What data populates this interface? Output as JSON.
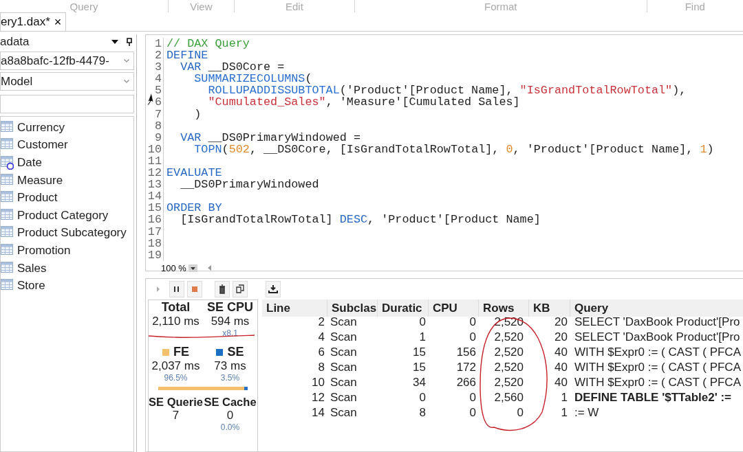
{
  "ribbon": {
    "groups": [
      "Query",
      "View",
      "Edit",
      "Format",
      "Find"
    ]
  },
  "document_tabs": [
    {
      "label": "ery1.dax*",
      "close": "×",
      "selected": true
    }
  ],
  "metadata_panel": {
    "title": "adata",
    "model_dropdown": "a8a8bafc-12fb-4479-",
    "perspective_dropdown": "Model",
    "tables": [
      {
        "label": "Currency",
        "kind": "table"
      },
      {
        "label": "Customer",
        "kind": "table"
      },
      {
        "label": "Date",
        "kind": "date"
      },
      {
        "label": "Measure",
        "kind": "table"
      },
      {
        "label": "Product",
        "kind": "table"
      },
      {
        "label": "Product Category",
        "kind": "table"
      },
      {
        "label": "Product Subcategory",
        "kind": "table"
      },
      {
        "label": "Promotion",
        "kind": "table"
      },
      {
        "label": "Sales",
        "kind": "table"
      },
      {
        "label": "Store",
        "kind": "table"
      }
    ]
  },
  "editor": {
    "zoom": "100 %",
    "lines": [
      {
        "number": "1",
        "tokens": [
          {
            "t": "// DAX Query",
            "kind": "comment"
          }
        ]
      },
      {
        "number": "2",
        "tokens": [
          {
            "t": "DEFINE",
            "kind": "keyword"
          }
        ]
      },
      {
        "number": "3",
        "tokens": [
          {
            "t": "  VAR",
            "kind": "keyword"
          },
          {
            "t": " __DS0Core =",
            "kind": "plain"
          }
        ]
      },
      {
        "number": "4",
        "tokens": [
          {
            "t": "    SUMMARIZECOLUMNS",
            "kind": "function"
          },
          {
            "t": "(",
            "kind": "plain"
          }
        ]
      },
      {
        "number": "5",
        "tokens": [
          {
            "t": "      ROLLUPADDISSUBTOTAL",
            "kind": "function"
          },
          {
            "t": "('Product'[Product Name], ",
            "kind": "plain"
          },
          {
            "t": "\"IsGrandTotalRowTotal\"",
            "kind": "string"
          },
          {
            "t": "),",
            "kind": "plain"
          }
        ]
      },
      {
        "number": "6",
        "tokens": [
          {
            "t": "      \"Cumulated_Sales\"",
            "kind": "string"
          },
          {
            "t": ", 'Measure'[Cumulated Sales]",
            "kind": "plain"
          }
        ]
      },
      {
        "number": "7",
        "tokens": [
          {
            "t": "    )",
            "kind": "plain"
          }
        ]
      },
      {
        "number": "8"
      },
      {
        "number": "9",
        "tokens": [
          {
            "t": "  VAR",
            "kind": "keyword"
          },
          {
            "t": " __DS0PrimaryWindowed =",
            "kind": "plain"
          }
        ]
      },
      {
        "number": "10",
        "tokens": [
          {
            "t": "    TOPN",
            "kind": "function"
          },
          {
            "t": "(",
            "kind": "plain"
          },
          {
            "t": "502",
            "kind": "number"
          },
          {
            "t": ", __DS0Core, [IsGrandTotalRowTotal], ",
            "kind": "plain"
          },
          {
            "t": "0",
            "kind": "number"
          },
          {
            "t": ", 'Product'[Product Name], ",
            "kind": "plain"
          },
          {
            "t": "1",
            "kind": "number"
          },
          {
            "t": ")",
            "kind": "plain"
          }
        ]
      },
      {
        "number": "11"
      },
      {
        "number": "12",
        "tokens": [
          {
            "t": "EVALUATE",
            "kind": "keyword"
          }
        ]
      },
      {
        "number": "13",
        "tokens": [
          {
            "t": "  __DS0PrimaryWindowed",
            "kind": "plain"
          }
        ]
      },
      {
        "number": "14"
      },
      {
        "number": "15",
        "tokens": [
          {
            "t": "ORDER BY",
            "kind": "keyword"
          }
        ]
      },
      {
        "number": "16",
        "tokens": [
          {
            "t": "  [IsGrandTotalRowTotal] ",
            "kind": "plain"
          },
          {
            "t": "DESC",
            "kind": "keyword"
          },
          {
            "t": ", 'Product'[Product Name]",
            "kind": "plain"
          }
        ]
      },
      {
        "number": "17"
      },
      {
        "number": "18"
      },
      {
        "number": "19"
      }
    ]
  },
  "trace_toolbar": [
    {
      "kind": "play",
      "disabled": true
    },
    {
      "kind": "pause",
      "disabled": false
    },
    {
      "kind": "stop",
      "disabled": false
    },
    {
      "kind": "clear",
      "disabled": false
    },
    {
      "kind": "copy",
      "disabled": false
    },
    {
      "kind": "export",
      "disabled": false
    }
  ],
  "summary": {
    "total_label": "Total",
    "total": "2,110 ms",
    "se_cpu_label": "SE CPU",
    "se_cpu": "594 ms",
    "se_cpu_ratio": "x8.1",
    "fe_label": "FE",
    "fe": "2,037 ms",
    "fe_pct": "96.5%",
    "se_label": "SE",
    "se": "73 ms",
    "se_pct": "3.5%",
    "level": 0.965,
    "se_queries_label": "SE Querie",
    "se_queries": "7",
    "se_cache_label": "SE Cache",
    "se_cache": "0",
    "se_cache_pct": "0.0%"
  },
  "trace_table": {
    "columns": [
      "Line",
      "Subclas",
      "Duratic",
      "CPU",
      "Rows",
      "KB",
      "Query"
    ],
    "rows": [
      {
        "cells": [
          "2",
          "Scan",
          "0",
          "0",
          "2,520",
          "20",
          "SELECT 'DaxBook Product'[Pro"
        ],
        "bold": false
      },
      {
        "cells": [
          "4",
          "Scan",
          "1",
          "0",
          "2,520",
          "20",
          "SELECT 'DaxBook Product'[Pro"
        ],
        "bold": false
      },
      {
        "cells": [
          "6",
          "Scan",
          "15",
          "156",
          "2,520",
          "40",
          "WITH $Expr0 := ( CAST ( PFCA"
        ],
        "bold": false
      },
      {
        "cells": [
          "8",
          "Scan",
          "15",
          "172",
          "2,520",
          "40",
          "WITH $Expr0 := ( CAST ( PFCA"
        ],
        "bold": false
      },
      {
        "cells": [
          "10",
          "Scan",
          "34",
          "266",
          "2,520",
          "40",
          "WITH $Expr0 := ( CAST ( PFCA"
        ],
        "bold": false
      },
      {
        "cells": [
          "12",
          "Scan",
          "0",
          "0",
          "2,560",
          "1",
          "DEFINE TABLE '$TTable2' :="
        ],
        "bold": true
      },
      {
        "cells": [
          "14",
          "Scan",
          "8",
          "0",
          "0",
          "1",
          ":= W"
        ],
        "bold": false
      }
    ]
  }
}
